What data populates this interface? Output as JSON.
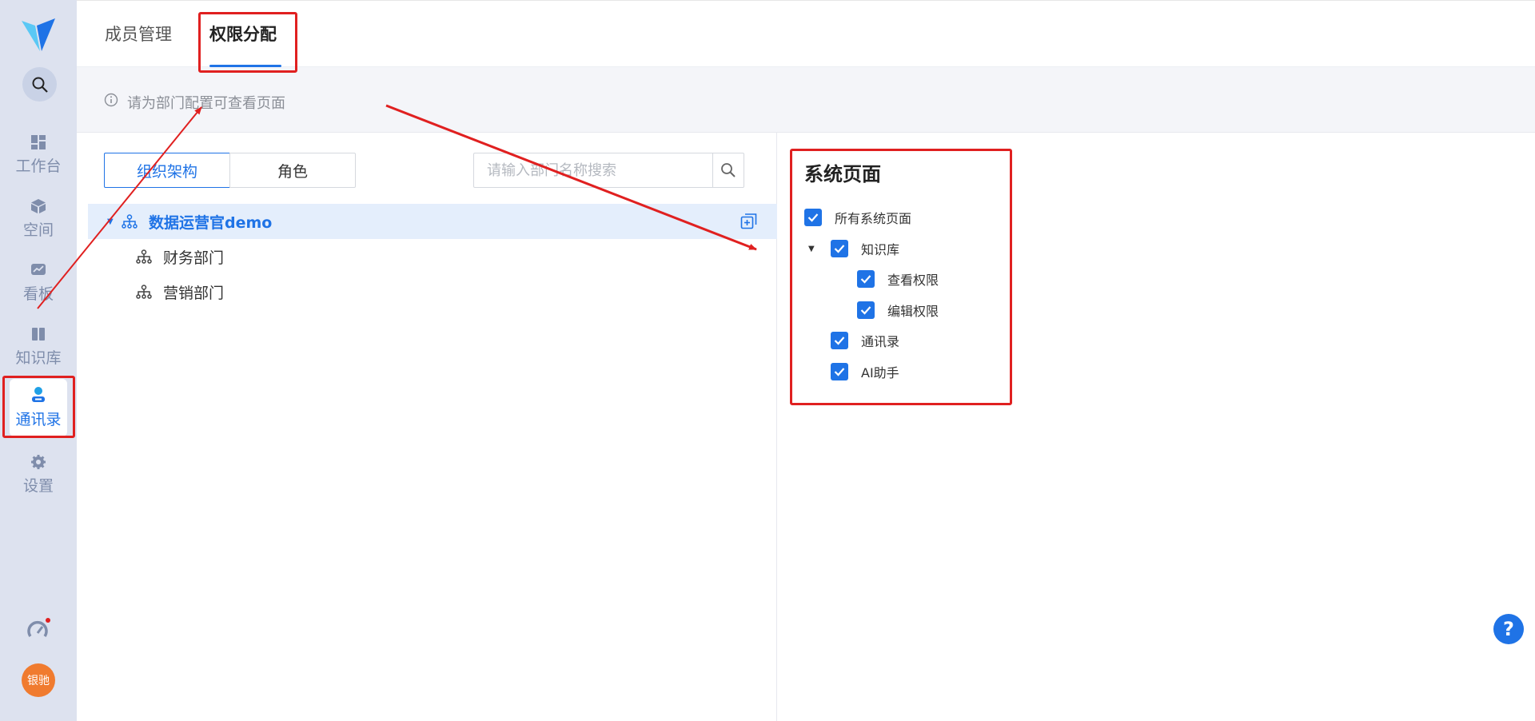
{
  "sidebar": {
    "items": [
      {
        "label": "工作台",
        "icon": "dashboard-icon"
      },
      {
        "label": "空间",
        "icon": "cube-icon"
      },
      {
        "label": "看板",
        "icon": "chart-board-icon"
      },
      {
        "label": "知识库",
        "icon": "book-icon"
      },
      {
        "label": "通讯录",
        "icon": "contacts-icon",
        "active": true
      },
      {
        "label": "设置",
        "icon": "gear-icon"
      }
    ],
    "avatar_text": "银驰"
  },
  "header": {
    "tabs": [
      {
        "label": "成员管理"
      },
      {
        "label": "权限分配",
        "active": true
      }
    ]
  },
  "notice": {
    "text": "请为部门配置可查看页面"
  },
  "left": {
    "segments": {
      "org": "组织架构",
      "role": "角色"
    },
    "search": {
      "placeholder": "请输入部门名称搜索"
    },
    "tree": [
      {
        "label": "数据运营官demo",
        "selected": true,
        "expanded": true
      },
      {
        "label": "财务部门"
      },
      {
        "label": "营销部门"
      }
    ]
  },
  "right": {
    "title": "系统页面",
    "options": [
      {
        "label": "所有系统页面",
        "checked": true
      },
      {
        "label": "知识库",
        "checked": true,
        "expanded": true
      },
      {
        "label": "查看权限",
        "checked": true
      },
      {
        "label": "编辑权限",
        "checked": true
      },
      {
        "label": "通讯录",
        "checked": true
      },
      {
        "label": "AI助手",
        "checked": true
      }
    ]
  },
  "help": {
    "symbol": "?"
  },
  "colors": {
    "accent": "#1f73e6",
    "annotation": "#e02020",
    "sidebar_bg": "#dde2ef",
    "avatar_bg": "#f07b2f"
  }
}
